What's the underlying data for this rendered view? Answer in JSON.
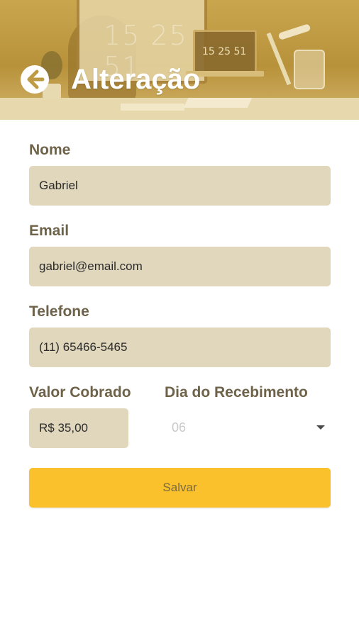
{
  "header": {
    "title": "Alteração",
    "back_icon": "arrow-left-circle-icon",
    "photo_clock_large": "15 25 51",
    "photo_clock_small": "15 25 51"
  },
  "form": {
    "name": {
      "label": "Nome",
      "value": "Gabriel"
    },
    "email": {
      "label": "Email",
      "value": "gabriel@email.com"
    },
    "phone": {
      "label": "Telefone",
      "value": "(11) 65466-5465"
    },
    "amount": {
      "label": "Valor Cobrado",
      "value": "R$ 35,00"
    },
    "payment_day": {
      "label": "Dia do Recebimento",
      "value": "06"
    },
    "save_label": "Salvar"
  },
  "colors": {
    "accent": "#fac12c",
    "field_background": "#e1d7bc",
    "label_text": "#6e6249",
    "header_tint": "#c9a64e"
  }
}
